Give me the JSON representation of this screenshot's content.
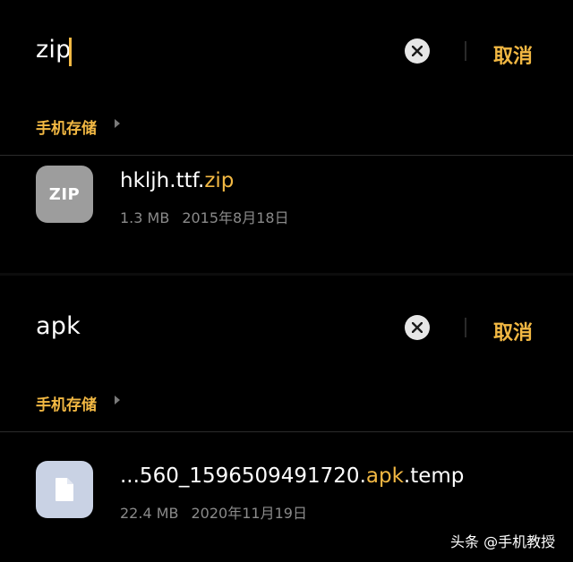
{
  "colors": {
    "accent": "#f2b843",
    "background": "#000000",
    "muted": "#8a8a8a"
  },
  "search_top": {
    "query": "zip",
    "cancel_label": "取消",
    "breadcrumb": "手机存储",
    "file": {
      "icon_label": "ZIP",
      "name_prefix": "hkljh.ttf.",
      "name_match": "zip",
      "size": "1.3 MB",
      "date": "2015年8月18日"
    }
  },
  "search_bottom": {
    "query": "apk",
    "cancel_label": "取消",
    "breadcrumb": "手机存储",
    "file": {
      "icon": "document-icon",
      "name_prefix": "...560_1596509491720.",
      "name_match": "apk",
      "name_suffix": ".temp",
      "size": "22.4 MB",
      "date": "2020年11月19日"
    }
  },
  "watermark": "头条 @手机教授"
}
